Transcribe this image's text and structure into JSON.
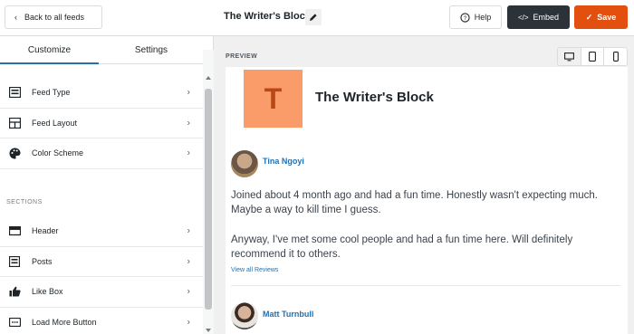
{
  "topbar": {
    "back_label": "Back to all feeds",
    "title": "The Writer's Block",
    "help_label": "Help",
    "embed_label": "Embed",
    "save_label": "Save"
  },
  "sidebar": {
    "tabs": [
      {
        "label": "Customize",
        "active": true
      },
      {
        "label": "Settings",
        "active": false
      }
    ],
    "items": [
      {
        "label": "Feed Type",
        "icon": "feed-type-icon"
      },
      {
        "label": "Feed Layout",
        "icon": "layout-icon"
      },
      {
        "label": "Color Scheme",
        "icon": "palette-icon"
      }
    ],
    "sections_title": "SECTIONS",
    "section_items": [
      {
        "label": "Header",
        "icon": "header-icon"
      },
      {
        "label": "Posts",
        "icon": "posts-icon"
      },
      {
        "label": "Like Box",
        "icon": "thumbs-up-icon"
      },
      {
        "label": "Load More Button",
        "icon": "load-more-icon"
      }
    ]
  },
  "preview": {
    "label": "PREVIEW",
    "devices": [
      "desktop-icon",
      "tablet-icon",
      "mobile-icon"
    ],
    "active_device": "desktop"
  },
  "feed": {
    "logo_letter": "T",
    "name": "The Writer's Block",
    "reviews": [
      {
        "name": "Tina Ngoyi",
        "paragraphs": [
          "Joined about 4 month ago and had a fun time. Honestly wasn't expecting much. Maybe a way to kill time I guess.",
          "Anyway, I've met some cool people and had a fun time here. Will definitely recommend it to others."
        ],
        "link": "View all Reviews"
      },
      {
        "name": "Matt Turnbull"
      }
    ]
  },
  "colors": {
    "accent": "#2271b1",
    "save": "#e34f0e",
    "embed": "#2c3338",
    "logo_bg": "#fa9c6a",
    "logo_fg": "#b84914"
  }
}
